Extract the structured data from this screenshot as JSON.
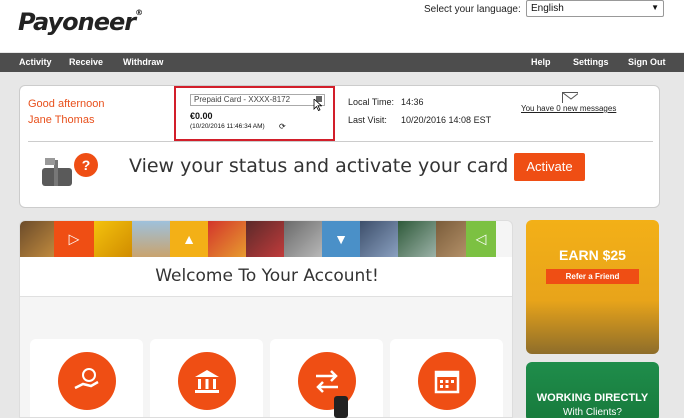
{
  "header": {
    "logo": "Payoneer",
    "language_label": "Select your language:",
    "language_value": "English"
  },
  "nav": {
    "activity": "Activity",
    "receive": "Receive",
    "withdraw": "Withdraw",
    "help": "Help",
    "settings": "Settings",
    "signout": "Sign Out"
  },
  "account": {
    "greeting": "Good afternoon",
    "name": "Jane Thomas",
    "card_select": "Prepaid Card - XXXX-8172",
    "balance": "€0.00",
    "balance_time": "(10/20/2016 11:46:34 AM)",
    "local_time_label": "Local Time:",
    "local_time": "14:36",
    "last_visit_label": "Last Visit:",
    "last_visit": "10/20/2016 14:08 EST",
    "messages": "You have 0 new messages",
    "status_text": "View your status and activate your card",
    "activate": "Activate"
  },
  "welcome": {
    "title": "Welcome To Your Account!"
  },
  "promo": {
    "earn": "EARN $25",
    "refer": "Refer a Friend",
    "working": "WORKING DIRECTLY",
    "clients": "With Clients?"
  },
  "colors": {
    "brand": "#ef4e14",
    "nav": "#4d4d4d",
    "highlight": "#d21e2a",
    "green": "#1f8d4b"
  },
  "icons": [
    "hand-globe-icon",
    "bank-icon",
    "transfer-icon",
    "calendar-icon",
    "mailbox-icon",
    "mail-icon",
    "refresh-icon"
  ]
}
